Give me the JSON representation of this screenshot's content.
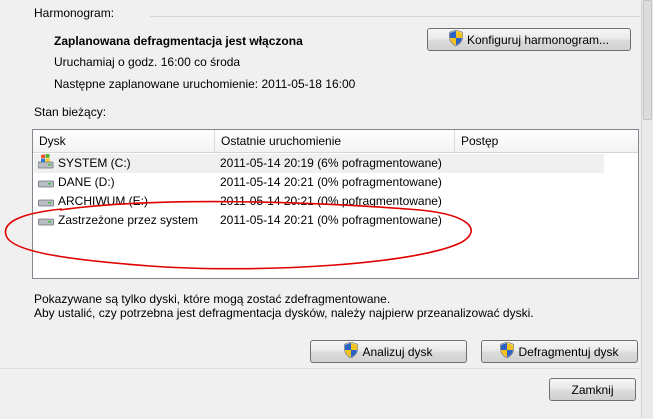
{
  "schedule": {
    "section_label": "Harmonogram:",
    "status": "Zaplanowana defragmentacja jest włączona",
    "runs": "Uruchamiaj o godz. 16:00 co środa",
    "next": "Następne zaplanowane uruchomienie: 2011-05-18 16:00",
    "configure_button": "Konfiguruj harmonogram..."
  },
  "current": {
    "section_label": "Stan bieżący:",
    "columns": [
      "Dysk",
      "Ostatnie uruchomienie",
      "Postęp"
    ],
    "rows": [
      {
        "disk": "SYSTEM (C:)",
        "last": "2011-05-14 20:19 (6% pofragmentowane)",
        "progress": "",
        "icon": "system-drive-icon"
      },
      {
        "disk": "DANE (D:)",
        "last": "2011-05-14 20:21 (0% pofragmentowane)",
        "progress": "",
        "icon": "hard-drive-icon"
      },
      {
        "disk": "ARCHIWUM (E:)",
        "last": "2011-05-14 20:21 (0% pofragmentowane)",
        "progress": "",
        "icon": "hard-drive-icon"
      },
      {
        "disk": "Zastrzeżone przez system",
        "last": "2011-05-14 20:21 (0% pofragmentowane)",
        "progress": "",
        "icon": "hard-drive-icon"
      }
    ]
  },
  "info": {
    "line1": "Pokazywane są tylko dyski, które mogą zostać zdefragmentowane.",
    "line2": "Aby ustalić, czy potrzebna jest defragmentacja dysków, należy najpierw przeanalizować dyski."
  },
  "actions": {
    "analyze": "Analizuj dysk",
    "defrag": "Defragmentuj dysk",
    "close": "Zamknij"
  },
  "colors": {
    "annotation": "#e00000",
    "background": "#f0f0f0"
  }
}
